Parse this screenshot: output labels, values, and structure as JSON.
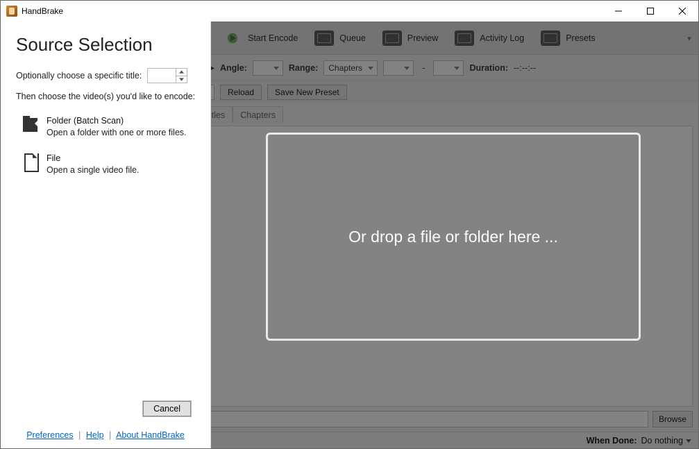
{
  "window": {
    "title": "HandBrake"
  },
  "toolbar": {
    "start_encode": "Start Encode",
    "queue": "Queue",
    "preview": "Preview",
    "activity_log": "Activity Log",
    "presets": "Presets"
  },
  "options": {
    "angle_label": "Angle:",
    "range_label": "Range:",
    "range_value": "Chapters",
    "range_dash": "-",
    "duration_label": "Duration:",
    "duration_value": "--:--:--",
    "reload": "Reload",
    "save_preset": "Save New Preset"
  },
  "tabs": {
    "titles": "itles",
    "chapters": "Chapters"
  },
  "dropzone": {
    "text": "Or drop a file or folder here ..."
  },
  "browse": {
    "label": "Browse"
  },
  "status": {
    "when_done_label": "When Done:",
    "when_done_value": "Do nothing"
  },
  "panel": {
    "heading": "Source Selection",
    "specific_title_label": "Optionally choose a specific title:",
    "specific_title_value": "",
    "choose_label": "Then choose the video(s) you'd like to encode:",
    "folder": {
      "title": "Folder (Batch Scan)",
      "desc": "Open a folder with one or more files."
    },
    "file": {
      "title": "File",
      "desc": "Open a single video file."
    },
    "cancel": "Cancel",
    "links": {
      "preferences": "Preferences",
      "help": "Help",
      "about": "About HandBrake",
      "sep": "|"
    }
  }
}
